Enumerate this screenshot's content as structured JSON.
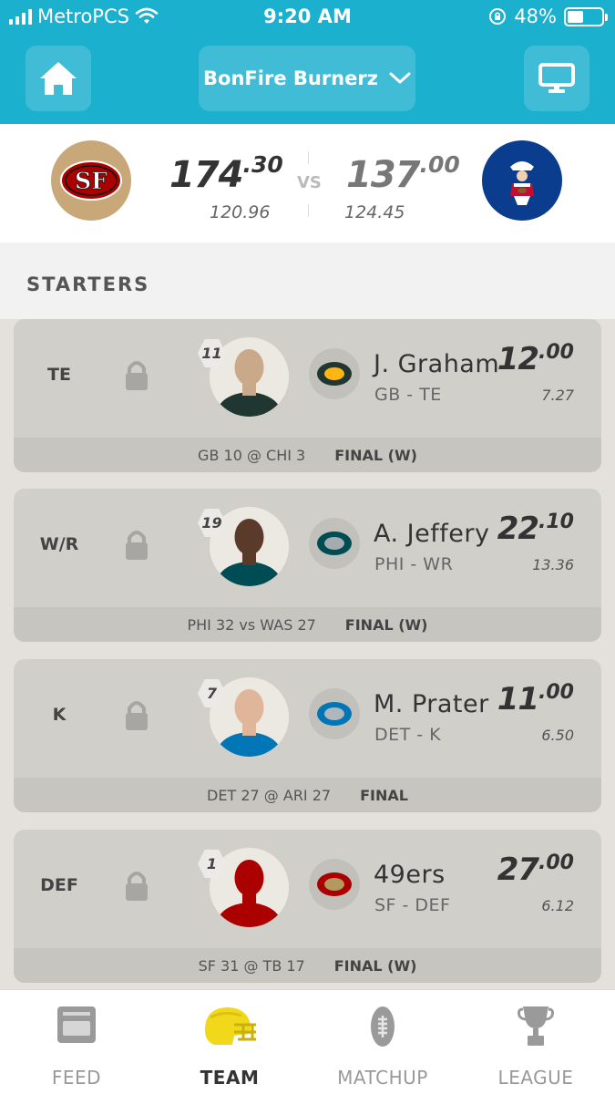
{
  "status": {
    "carrier": "MetroPCS",
    "time": "9:20 AM",
    "battery": "48%",
    "battery_level": 0.48
  },
  "nav": {
    "team_name": "BonFire Burnerz"
  },
  "matchup": {
    "home": {
      "score_int": "174",
      "score_dec": ".30",
      "projected": "120.96"
    },
    "away": {
      "score_int": "137",
      "score_dec": ".00",
      "projected": "124.45"
    },
    "vs": "VS"
  },
  "section_title": "STARTERS",
  "starters": [
    {
      "pos": "TE",
      "number": "11",
      "name": "J. Graham",
      "team_pos": "GB - TE",
      "pts_int": "12",
      "pts_dec": ".00",
      "proj": "7.27",
      "game": "GB 10 @ CHI 3",
      "result": "FINAL (W)",
      "team_icon": "packers-logo",
      "colors": {
        "jersey": "#203731",
        "skin": "#c9a98a",
        "badge_bg": "#203731",
        "badge_accent": "#ffb612"
      }
    },
    {
      "pos": "W/R",
      "number": "19",
      "name": "A. Jeffery",
      "team_pos": "PHI - WR",
      "pts_int": "22",
      "pts_dec": ".10",
      "proj": "13.36",
      "game": "PHI 32 vs WAS 27",
      "result": "FINAL (W)",
      "team_icon": "eagles-logo",
      "colors": {
        "jersey": "#004c54",
        "skin": "#5a3a28",
        "badge_bg": "#004c54",
        "badge_accent": "#a5acaf"
      }
    },
    {
      "pos": "K",
      "number": "7",
      "name": "M. Prater",
      "team_pos": "DET - K",
      "pts_int": "11",
      "pts_dec": ".00",
      "proj": "6.50",
      "game": "DET 27 @ ARI 27",
      "result": "FINAL",
      "team_icon": "lions-logo",
      "colors": {
        "jersey": "#0076b6",
        "skin": "#e0b69a",
        "badge_bg": "#0076b6",
        "badge_accent": "#b0b7bc"
      }
    },
    {
      "pos": "DEF",
      "number": "1",
      "name": "49ers",
      "team_pos": "SF - DEF",
      "pts_int": "27",
      "pts_dec": ".00",
      "proj": "6.12",
      "game": "SF 31 @ TB 17",
      "result": "FINAL (W)",
      "team_icon": "49ers-logo",
      "colors": {
        "jersey": "#aa0000",
        "skin": "#aa0000",
        "badge_bg": "#aa0000",
        "badge_accent": "#b3995d"
      }
    }
  ],
  "tabs": [
    {
      "label": "FEED",
      "icon": "feed-icon",
      "active": false
    },
    {
      "label": "TEAM",
      "icon": "helmet-icon",
      "active": true
    },
    {
      "label": "MATCHUP",
      "icon": "football-icon",
      "active": false
    },
    {
      "label": "LEAGUE",
      "icon": "trophy-icon",
      "active": false
    }
  ],
  "colors": {
    "brand": "#1cb0cf",
    "card": "#d1cfca",
    "card_footer": "#c7c5c0",
    "active_tab_icon": "#f2d81a",
    "inactive_icon": "#9a9a9a"
  }
}
